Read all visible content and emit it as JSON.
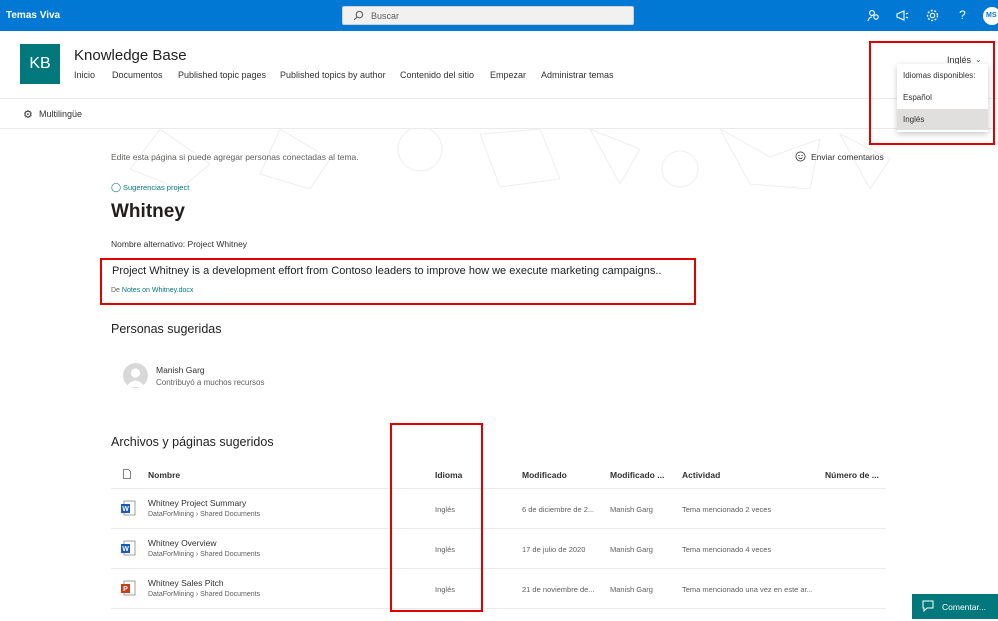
{
  "suite_bar": {
    "app_name": "Temas Viva",
    "search_placeholder": "Buscar",
    "user_initials": "MS",
    "icons": [
      "people-icon",
      "megaphone-icon",
      "gear-icon",
      "help-icon"
    ]
  },
  "site": {
    "logo_text": "KB",
    "title": "Knowledge Base",
    "nav": [
      "Inicio",
      "Documentos",
      "Published topic pages",
      "Published topics by author",
      "Contenido del sitio",
      "Empezar",
      "Administrar temas"
    ],
    "language_selector": "Inglés"
  },
  "command_bar": {
    "multilingual_label": "Multilingüe"
  },
  "language_dropdown": {
    "header": "Idiomas disponibles:",
    "options": [
      "Español",
      "Inglés"
    ],
    "selected": "Inglés"
  },
  "topic": {
    "edit_hint": "Edite esta página si puede agregar personas conectadas al tema.",
    "feedback_label": "Enviar comentarios",
    "suggestion_label": "Sugerencias project",
    "title": "Whitney",
    "alt_name": "Nombre alternativo: Project Whitney",
    "description": "Project Whitney is a development effort from Contoso leaders to improve how we execute marketing campaigns..",
    "source_prefix": "De",
    "source_link": "Notes on Whitney.docx"
  },
  "people": {
    "heading": "Personas sugeridas",
    "items": [
      {
        "name": "Manish Garg",
        "subtitle": "Contribuyó a muchos recursos"
      }
    ]
  },
  "files": {
    "heading": "Archivos y páginas sugeridos",
    "columns": [
      "Nombre",
      "Idioma",
      "Modificado",
      "Modificado ...",
      "Actividad",
      "Número de ..."
    ],
    "rows": [
      {
        "type": "word",
        "name": "Whitney Project Summary",
        "path": "DataForMining › Shared Documents",
        "language": "Inglés",
        "modified": "6 de diciembre de 2...",
        "modified_by": "Manish Garg",
        "activity": "Tema mencionado 2 veces"
      },
      {
        "type": "word",
        "name": "Whitney Overview",
        "path": "DataForMining › Shared Documents",
        "language": "Inglés",
        "modified": "17 de julio de 2020",
        "modified_by": "Manish Garg",
        "activity": "Tema mencionado 4 veces"
      },
      {
        "type": "powerpoint",
        "name": "Whitney Sales Pitch",
        "path": "DataForMining › Shared Documents",
        "language": "Inglés",
        "modified": "21 de noviembre de...",
        "modified_by": "Manish Garg",
        "activity": "Tema mencionado una vez en este ar..."
      }
    ]
  },
  "comment_button": "Comentar...",
  "colors": {
    "suite_blue": "#0078d4",
    "teal": "#03787c",
    "highlight_red": "#e00000"
  }
}
